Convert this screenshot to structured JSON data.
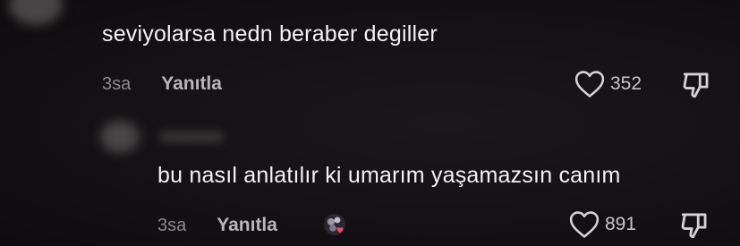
{
  "comments": [
    {
      "text": "seviyolarsa nedn beraber degiller",
      "time": "3sa",
      "reply_label": "Yanıtla",
      "likes": "352"
    },
    {
      "text": "bu nasıl anlatılır ki umarım yaşamazsın canım",
      "time": "3sa",
      "reply_label": "Yanıtla",
      "likes": "891"
    }
  ],
  "icons": {
    "like": "heart-outline-icon",
    "dislike": "thumbs-down-icon",
    "sticker": "heart-sticker-icon"
  },
  "colors": {
    "background": "#141214",
    "text": "#f3f3f3",
    "meta": "#8d8a8c",
    "sticker_heart": "#e0506a"
  }
}
